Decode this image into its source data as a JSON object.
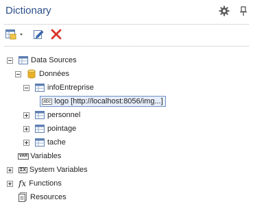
{
  "header": {
    "title": "Dictionary",
    "icons": [
      "gear-icon",
      "pin-icon"
    ]
  },
  "toolbar": {
    "buttons": [
      {
        "name": "add-datasource-button",
        "icon": "table-add-icon"
      },
      {
        "name": "edit-button",
        "icon": "pencil-icon"
      },
      {
        "name": "delete-button",
        "icon": "x-icon"
      }
    ]
  },
  "tree": {
    "data_sources": "Data Sources",
    "donnees": "Données",
    "info_entreprise": "infoEntreprise",
    "logo": "logo [http://localhost:8056/img...]",
    "logo_badge": "abc",
    "personnel": "personnel",
    "pointage": "pointage",
    "tache": "tache",
    "variables": "Variables",
    "variables_badge": "VAR",
    "system_variables": "System Variables",
    "system_variables_badge": "ΣX",
    "functions": "Functions",
    "functions_badge": "fx",
    "resources": "Resources"
  },
  "colors": {
    "title": "#2c4f86",
    "selection_border": "#6f8fc7",
    "selection_fill": "#e7eefb",
    "delete_red": "#d8322a",
    "db_yellow": "#e9b22b"
  }
}
